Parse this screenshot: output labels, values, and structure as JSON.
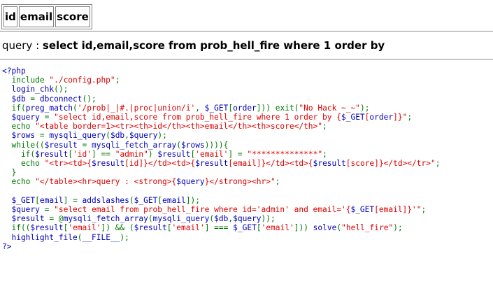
{
  "table": {
    "headers": [
      "id",
      "email",
      "score"
    ]
  },
  "query": {
    "label": "query : ",
    "value": "select id,email,score from prob_hell_fire where 1 order by"
  },
  "source": {
    "lines": [
      [
        [
          "d",
          "<?php"
        ]
      ],
      [
        [
          "k",
          "  include "
        ],
        [
          "s",
          "\"./config.php\""
        ],
        [
          "k",
          ";"
        ]
      ],
      [
        [
          "d",
          "  login_chk"
        ],
        [
          "k",
          "();"
        ]
      ],
      [
        [
          "d",
          "  $db "
        ],
        [
          "k",
          "= "
        ],
        [
          "d",
          "dbconnect"
        ],
        [
          "k",
          "();"
        ]
      ],
      [
        [
          "k",
          "  if("
        ],
        [
          "d",
          "preg_match"
        ],
        [
          "k",
          "("
        ],
        [
          "s",
          "'/prob|_|#.|proc|union/i'"
        ],
        [
          "k",
          ", "
        ],
        [
          "d",
          "$_GET"
        ],
        [
          "k",
          "["
        ],
        [
          "d",
          "order"
        ],
        [
          "k",
          "])) exit("
        ],
        [
          "s",
          "\"No Hack ~_~\""
        ],
        [
          "k",
          ");"
        ]
      ],
      [
        [
          "d",
          "  $query "
        ],
        [
          "k",
          "= "
        ],
        [
          "s",
          "\"select id,email,score from prob_hell_fire where 1 order by {"
        ],
        [
          "d",
          "$_GET"
        ],
        [
          "s",
          "["
        ],
        [
          "d",
          "order"
        ],
        [
          "s",
          "]}\""
        ],
        [
          "k",
          ";"
        ]
      ],
      [
        [
          "k",
          "  echo "
        ],
        [
          "s",
          "\"<table border=1><tr><th>id</th><th>email</th><th>score</th>\""
        ],
        [
          "k",
          ";"
        ]
      ],
      [
        [
          "d",
          "  $rows "
        ],
        [
          "k",
          "= "
        ],
        [
          "d",
          "mysqli_query"
        ],
        [
          "k",
          "("
        ],
        [
          "d",
          "$db"
        ],
        [
          "k",
          ","
        ],
        [
          "d",
          "$query"
        ],
        [
          "k",
          ");"
        ]
      ],
      [
        [
          "k",
          "  while(("
        ],
        [
          "d",
          "$result "
        ],
        [
          "k",
          "= "
        ],
        [
          "d",
          "mysqli_fetch_array"
        ],
        [
          "k",
          "("
        ],
        [
          "d",
          "$rows"
        ],
        [
          "k",
          ")))){"
        ]
      ],
      [
        [
          "k",
          "    if("
        ],
        [
          "d",
          "$result"
        ],
        [
          "k",
          "["
        ],
        [
          "s",
          "'id'"
        ],
        [
          "k",
          "] == "
        ],
        [
          "s",
          "\"admin\""
        ],
        [
          "k",
          ") "
        ],
        [
          "d",
          "$result"
        ],
        [
          "k",
          "["
        ],
        [
          "s",
          "'email'"
        ],
        [
          "k",
          "] = "
        ],
        [
          "s",
          "\"**************\""
        ],
        [
          "k",
          ";"
        ]
      ],
      [
        [
          "k",
          "    echo "
        ],
        [
          "s",
          "\"<tr><td>{"
        ],
        [
          "d",
          "$result"
        ],
        [
          "s",
          "[id]}</td><td>{"
        ],
        [
          "d",
          "$result"
        ],
        [
          "s",
          "[email]}</td><td>{"
        ],
        [
          "d",
          "$result"
        ],
        [
          "s",
          "[score]}</td></tr>\""
        ],
        [
          "k",
          ";"
        ]
      ],
      [
        [
          "k",
          "  }"
        ]
      ],
      [
        [
          "k",
          "  echo "
        ],
        [
          "s",
          "\"</table><hr>query : <strong>{"
        ],
        [
          "d",
          "$query"
        ],
        [
          "s",
          "}</strong><hr>\""
        ],
        [
          "k",
          ";"
        ]
      ],
      [
        [
          "d",
          " "
        ]
      ],
      [
        [
          "d",
          "  $_GET"
        ],
        [
          "k",
          "["
        ],
        [
          "d",
          "email"
        ],
        [
          "k",
          "] = "
        ],
        [
          "d",
          "addslashes"
        ],
        [
          "k",
          "("
        ],
        [
          "d",
          "$_GET"
        ],
        [
          "k",
          "["
        ],
        [
          "d",
          "email"
        ],
        [
          "k",
          "]);"
        ]
      ],
      [
        [
          "d",
          "  $query "
        ],
        [
          "k",
          "= "
        ],
        [
          "s",
          "\"select email from prob_hell_fire where id='admin' and email='{"
        ],
        [
          "d",
          "$_GET"
        ],
        [
          "s",
          "[email]}'\""
        ],
        [
          "k",
          ";"
        ]
      ],
      [
        [
          "d",
          "  $result "
        ],
        [
          "k",
          "= @"
        ],
        [
          "d",
          "mysqli_fetch_array"
        ],
        [
          "k",
          "("
        ],
        [
          "d",
          "mysqli_query"
        ],
        [
          "k",
          "("
        ],
        [
          "d",
          "$db"
        ],
        [
          "k",
          ","
        ],
        [
          "d",
          "$query"
        ],
        [
          "k",
          "));"
        ]
      ],
      [
        [
          "k",
          "  if(("
        ],
        [
          "d",
          "$result"
        ],
        [
          "k",
          "["
        ],
        [
          "s",
          "'email'"
        ],
        [
          "k",
          "]) && ("
        ],
        [
          "d",
          "$result"
        ],
        [
          "k",
          "["
        ],
        [
          "s",
          "'email'"
        ],
        [
          "k",
          "] === "
        ],
        [
          "d",
          "$_GET"
        ],
        [
          "k",
          "["
        ],
        [
          "s",
          "'email'"
        ],
        [
          "k",
          "])) "
        ],
        [
          "d",
          "solve"
        ],
        [
          "k",
          "("
        ],
        [
          "s",
          "\"hell_fire\""
        ],
        [
          "k",
          ");"
        ]
      ],
      [
        [
          "d",
          "  highlight_file"
        ],
        [
          "k",
          "("
        ],
        [
          "d",
          "__FILE__"
        ],
        [
          "k",
          ");"
        ]
      ],
      [
        [
          "d",
          "?>"
        ]
      ]
    ],
    "colors": {
      "default": "#0000BB",
      "keyword": "#007700",
      "string": "#DD0000"
    }
  }
}
